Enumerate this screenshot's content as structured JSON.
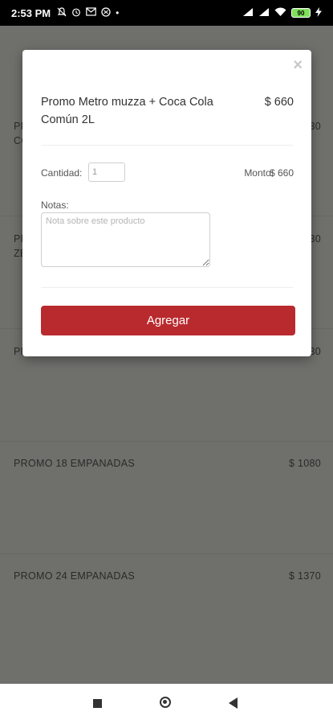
{
  "status_bar": {
    "time": "2:53 PM",
    "battery": "90",
    "left_icons": [
      "mute-icon",
      "alarm-icon",
      "gmail-icon",
      "vpn-icon"
    ],
    "right_icons": [
      "signal-icon",
      "signal-icon",
      "wifi-icon",
      "battery-icon",
      "charging-icon"
    ]
  },
  "background_list": [
    {
      "name": "PR",
      "name2": "CO",
      "price": "30"
    },
    {
      "name": "PR",
      "name2": "ZE",
      "price": "30"
    },
    {
      "name": "PR",
      "name2": "",
      "price": "30"
    },
    {
      "name": "PROMO 18 EMPANADAS",
      "price": "$ 1080"
    },
    {
      "name": "PROMO 24 EMPANADAS",
      "price": "$ 1370"
    }
  ],
  "modal": {
    "close_symbol": "×",
    "product_name": "Promo Metro muzza + Coca Cola Común 2L",
    "product_price": "$ 660",
    "quantity_label": "Cantidad:",
    "quantity_value": "1",
    "monto_label": "Monto:",
    "monto_value": "$ 660",
    "notes_label": "Notas:",
    "notes_placeholder": "Nota sobre este producto",
    "add_button_label": "Agregar",
    "accent_color": "#b92a2e"
  },
  "nav_bar": {
    "icons": [
      "recent-apps-icon",
      "home-icon",
      "back-icon"
    ]
  }
}
